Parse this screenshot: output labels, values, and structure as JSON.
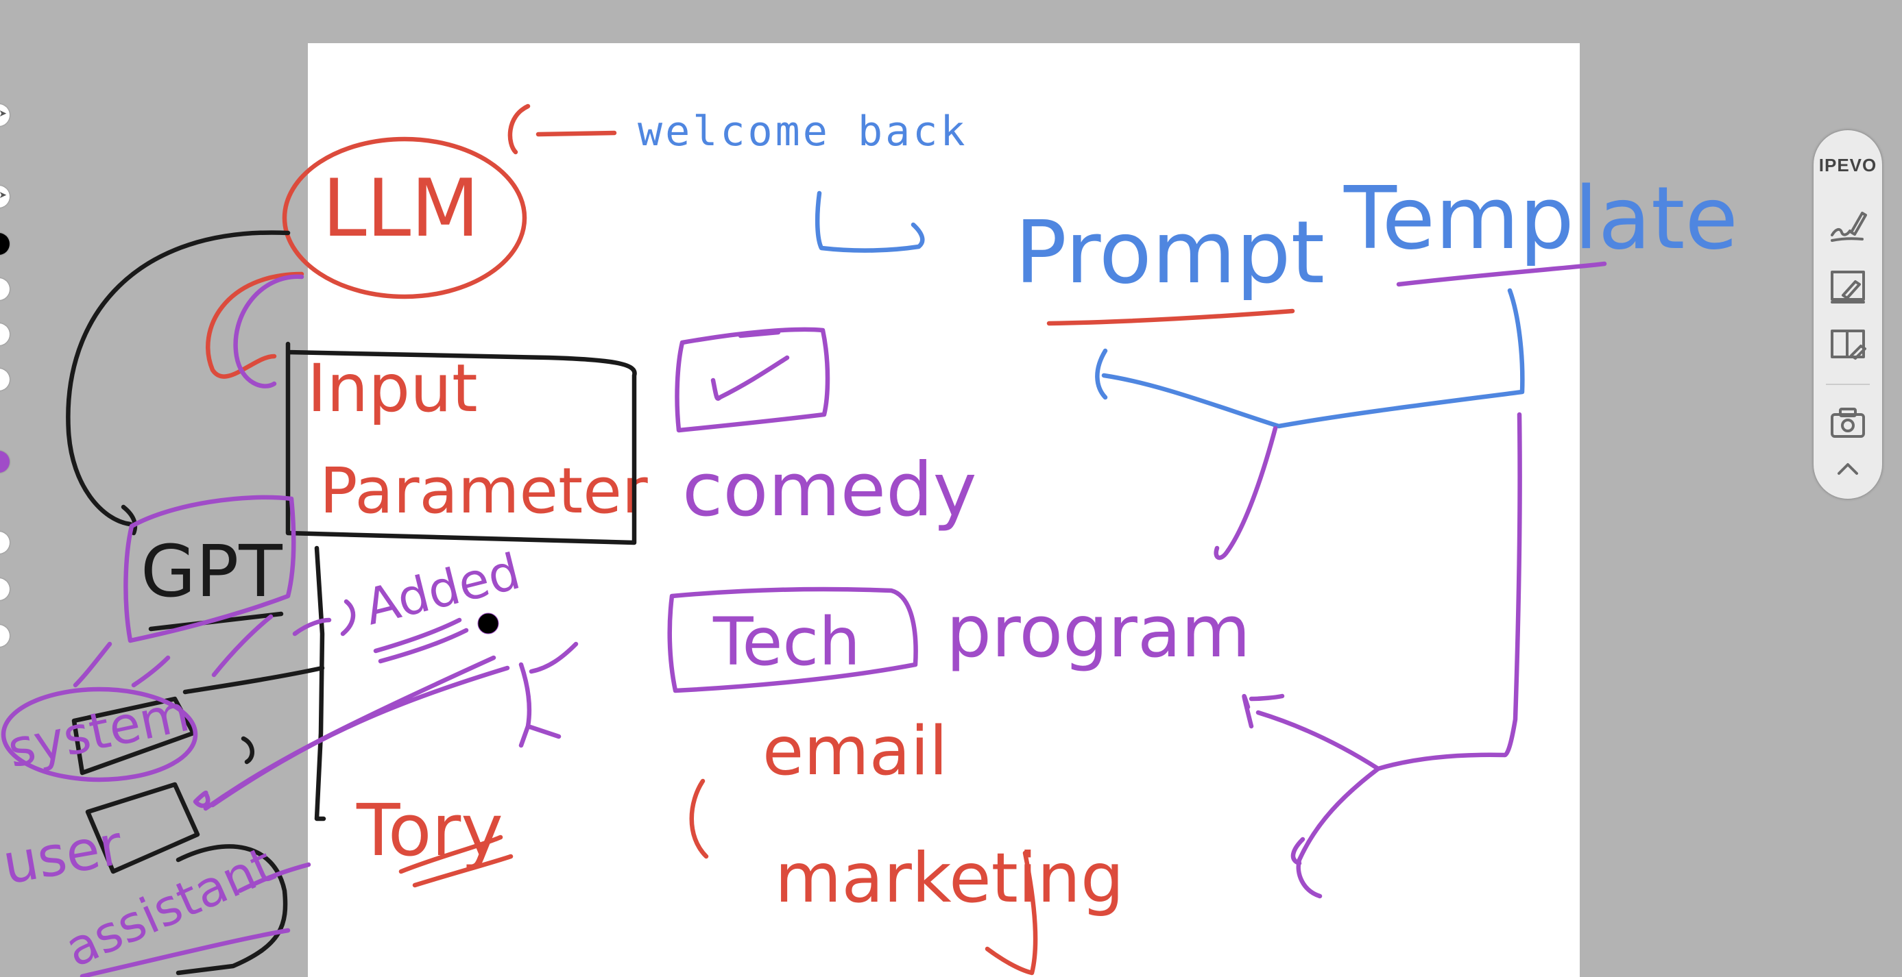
{
  "board": {
    "typed_text": "welcome back"
  },
  "ink": {
    "llm": "LLM",
    "input": "Input",
    "parameter": "Parameter",
    "gpt": "GPT",
    "added": "Added",
    "system": "system",
    "user": "user",
    "assistant": "assistant",
    "tory": "Tory",
    "comedy": "comedy",
    "tech": "Tech",
    "program": "program",
    "email": "email",
    "marketing": "marketing",
    "prompt": "Prompt",
    "template": "Template"
  },
  "colors": {
    "ink_red": "#dc4b3c",
    "ink_blue": "#4f86e0",
    "ink_purple": "#a04cc8",
    "ink_black": "#1a1a1a",
    "background": "#b3b3b3",
    "board": "#ffffff"
  },
  "palette": {
    "colors": [
      "#ffffff",
      "#ffffff",
      "#000000",
      "#ffffff",
      "#ffffff",
      "#ffffff",
      "#a04cc8",
      "#ffffff",
      "#ffffff",
      "#ffffff"
    ]
  },
  "toolbar": {
    "brand": "IPEVO",
    "tools": [
      {
        "icon": "pen-annotate-icon"
      },
      {
        "icon": "whiteboard-icon"
      },
      {
        "icon": "freeze-screen-icon"
      },
      {
        "icon": "camera-icon"
      },
      {
        "icon": "chevron-up-icon"
      }
    ]
  }
}
